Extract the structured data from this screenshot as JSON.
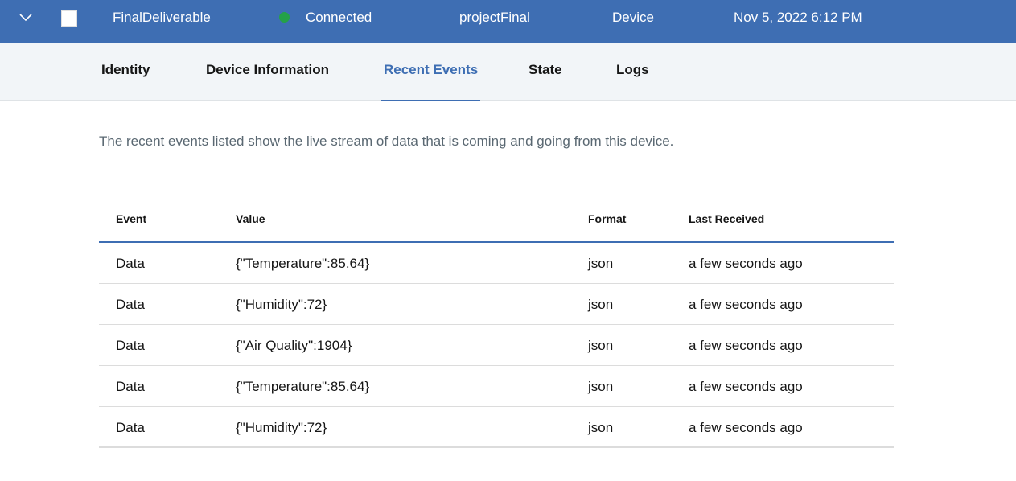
{
  "device_row": {
    "name": "FinalDeliverable",
    "status": "Connected",
    "status_color": "#24a148",
    "project": "projectFinal",
    "type": "Device",
    "timestamp": "Nov 5, 2022 6:12 PM",
    "header_color": "#3e6eb3"
  },
  "tabs": [
    {
      "label": "Identity",
      "active": false
    },
    {
      "label": "Device Information",
      "active": false
    },
    {
      "label": "Recent Events",
      "active": true
    },
    {
      "label": "State",
      "active": false
    },
    {
      "label": "Logs",
      "active": false
    }
  ],
  "description": "The recent events listed show the live stream of data that is coming and going from this device.",
  "table": {
    "headers": [
      "Event",
      "Value",
      "Format",
      "Last Received"
    ],
    "rows": [
      {
        "event": "Data",
        "value": "{\"Temperature\":85.64}",
        "format": "json",
        "last_received": "a few seconds ago"
      },
      {
        "event": "Data",
        "value": "{\"Humidity\":72}",
        "format": "json",
        "last_received": "a few seconds ago"
      },
      {
        "event": "Data",
        "value": "{\"Air Quality\":1904}",
        "format": "json",
        "last_received": "a few seconds ago"
      },
      {
        "event": "Data",
        "value": "{\"Temperature\":85.64}",
        "format": "json",
        "last_received": "a few seconds ago"
      },
      {
        "event": "Data",
        "value": "{\"Humidity\":72}",
        "format": "json",
        "last_received": "a few seconds ago"
      }
    ]
  }
}
